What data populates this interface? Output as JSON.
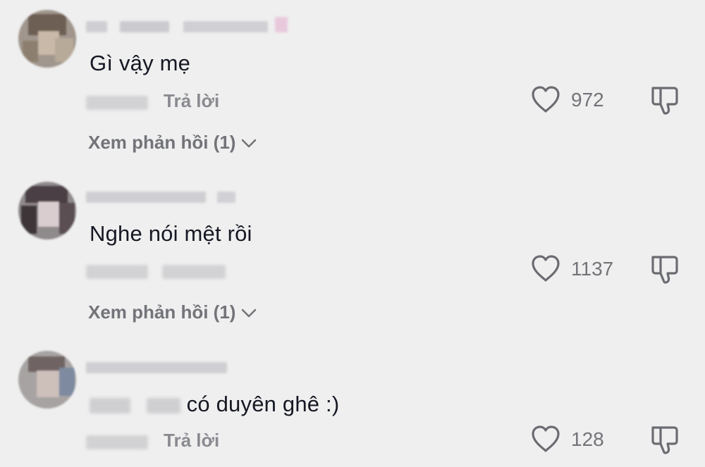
{
  "comments": [
    {
      "text": "Gì vậy mẹ",
      "reply_label": "Trả lời",
      "likes": "972",
      "view_replies": "Xem phản hồi (1)"
    },
    {
      "text": "Nghe nói mệt rồi",
      "likes": "1137",
      "view_replies": "Xem phản hồi (1)"
    },
    {
      "text_visible": "có duyên ghê :)",
      "reply_label": "Trả lời",
      "likes": "128"
    }
  ],
  "icons": {
    "like": "heart-outline-icon",
    "dislike": "thumbs-down-outline-icon",
    "expand": "chevron-down-icon"
  },
  "colors": {
    "background": "#efefef",
    "text": "#161823",
    "secondary": "#737479",
    "icon": "#6b6c72"
  }
}
